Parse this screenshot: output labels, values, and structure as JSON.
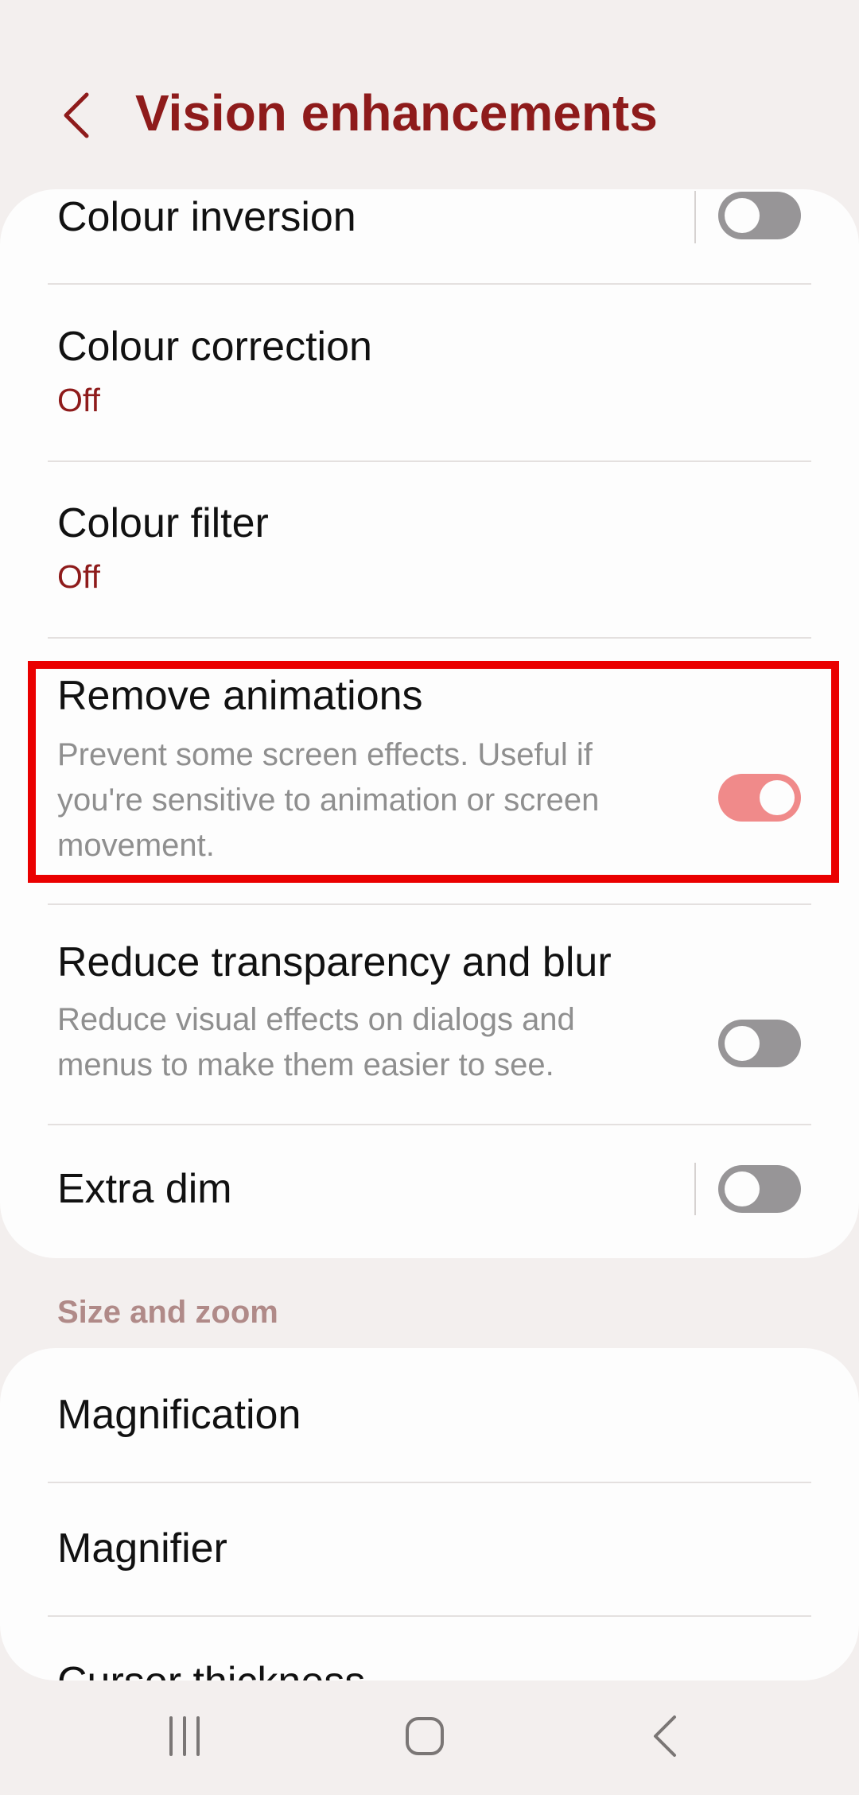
{
  "header": {
    "title": "Vision enhancements",
    "back_icon": "chevron-left-icon",
    "accent_color": "#8e1b1b"
  },
  "vision_items": [
    {
      "title": "Colour inversion",
      "toggle": "off"
    },
    {
      "title": "Colour correction",
      "status": "Off"
    },
    {
      "title": "Colour filter",
      "status": "Off"
    },
    {
      "title": "Remove animations",
      "description": "Prevent some screen effects. Useful if you're sensitive to animation or screen movement.",
      "toggle": "on",
      "highlighted": true
    },
    {
      "title": "Reduce transparency and blur",
      "description": "Reduce visual effects on dialogs and menus to make them easier to see.",
      "toggle": "off"
    },
    {
      "title": "Extra dim",
      "toggle": "off"
    }
  ],
  "size_zoom": {
    "section_header": "Size and zoom",
    "items": [
      {
        "title": "Magnification"
      },
      {
        "title": "Magnifier"
      },
      {
        "title": "Cursor thickness"
      }
    ]
  },
  "navbar": {
    "recents_icon": "recents-icon",
    "home_icon": "home-icon",
    "back_icon": "back-icon"
  },
  "colors": {
    "toggle_on": "#f08a8a",
    "toggle_off": "#979597",
    "highlight": "#ea0000",
    "section_header": "#b08a88"
  }
}
